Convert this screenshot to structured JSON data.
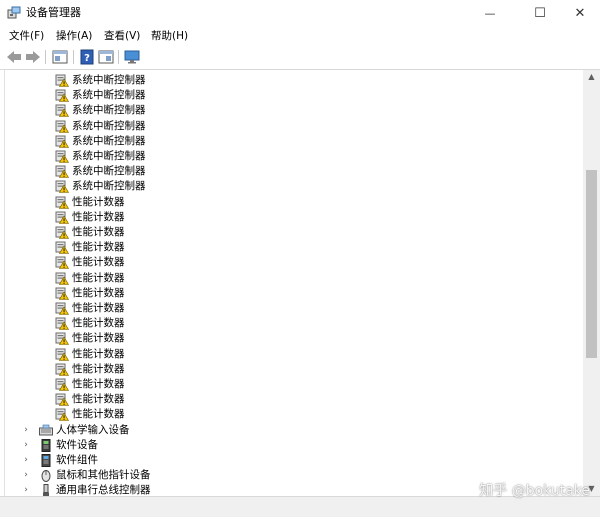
{
  "window": {
    "title": "设备管理器",
    "minimize_glyph": "—",
    "maximize_glyph": "☐",
    "close_glyph": "✕"
  },
  "menu": [
    {
      "label": "文件(F)"
    },
    {
      "label": "操作(A)"
    },
    {
      "label": "查看(V)"
    },
    {
      "label": "帮助(H)"
    }
  ],
  "toolbar": {
    "icons": [
      "back-arrow-icon",
      "forward-arrow-icon",
      "properties-panel-icon",
      "help-icon",
      "details-panel-icon",
      "monitor-icon"
    ]
  },
  "tree": {
    "child_items": [
      {
        "label": "系统中断控制器",
        "icon": "device-warning-icon"
      },
      {
        "label": "系统中断控制器",
        "icon": "device-warning-icon"
      },
      {
        "label": "系统中断控制器",
        "icon": "device-warning-icon"
      },
      {
        "label": "系统中断控制器",
        "icon": "device-warning-icon"
      },
      {
        "label": "系统中断控制器",
        "icon": "device-warning-icon"
      },
      {
        "label": "系统中断控制器",
        "icon": "device-warning-icon"
      },
      {
        "label": "系统中断控制器",
        "icon": "device-warning-icon"
      },
      {
        "label": "系统中断控制器",
        "icon": "device-warning-icon"
      },
      {
        "label": "性能计数器",
        "icon": "device-warning-icon"
      },
      {
        "label": "性能计数器",
        "icon": "device-warning-icon"
      },
      {
        "label": "性能计数器",
        "icon": "device-warning-icon"
      },
      {
        "label": "性能计数器",
        "icon": "device-warning-icon"
      },
      {
        "label": "性能计数器",
        "icon": "device-warning-icon"
      },
      {
        "label": "性能计数器",
        "icon": "device-warning-icon"
      },
      {
        "label": "性能计数器",
        "icon": "device-warning-icon"
      },
      {
        "label": "性能计数器",
        "icon": "device-warning-icon"
      },
      {
        "label": "性能计数器",
        "icon": "device-warning-icon"
      },
      {
        "label": "性能计数器",
        "icon": "device-warning-icon"
      },
      {
        "label": "性能计数器",
        "icon": "device-warning-icon"
      },
      {
        "label": "性能计数器",
        "icon": "device-warning-icon"
      },
      {
        "label": "性能计数器",
        "icon": "device-warning-icon"
      },
      {
        "label": "性能计数器",
        "icon": "device-warning-icon"
      },
      {
        "label": "性能计数器",
        "icon": "device-warning-icon"
      }
    ],
    "categories": [
      {
        "label": "人体学输入设备",
        "icon": "keyboard-icon",
        "expander": "›"
      },
      {
        "label": "软件设备",
        "icon": "software-device-icon",
        "expander": "›"
      },
      {
        "label": "软件组件",
        "icon": "software-component-icon",
        "expander": "›"
      },
      {
        "label": "鼠标和其他指针设备",
        "icon": "mouse-icon",
        "expander": "›"
      },
      {
        "label": "通用串行总线控制器",
        "icon": "usb-icon",
        "expander": "›"
      }
    ]
  },
  "scrollbar": {
    "up_glyph": "▲",
    "down_glyph": "▼"
  },
  "watermark": "知乎 @bokutake",
  "colors": {
    "warning": "#f5c400",
    "selection": "#cce8ff",
    "window_bg": "#ffffff"
  }
}
